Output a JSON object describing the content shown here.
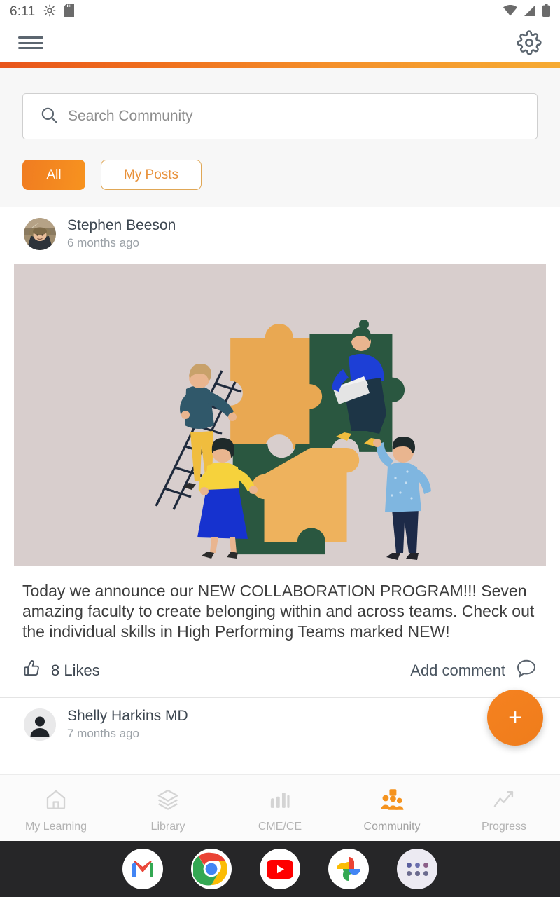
{
  "status_bar": {
    "time": "6:11",
    "icons": [
      "android-debug-icon",
      "sd-card-icon",
      "wifi-icon",
      "cellular-signal-icon",
      "battery-icon"
    ]
  },
  "app_bar": {
    "menu_icon": "hamburger-menu-icon",
    "settings_icon": "gear-icon"
  },
  "theme": {
    "accent_start": "#e8551c",
    "accent_end": "#f6ab33",
    "chip_active_bg": "#f7931f",
    "chip_inactive_text": "#e8913a",
    "fab_color": "#f58220",
    "nav_active_color": "#f5931e",
    "illustration_bg": "#d8cecd",
    "puzzle_orange": "#e9a852",
    "puzzle_green": "#2a5740"
  },
  "search": {
    "placeholder": "Search Community",
    "value": "",
    "icon": "search-icon"
  },
  "filters": [
    {
      "label": "All",
      "active": true
    },
    {
      "label": "My Posts",
      "active": false
    }
  ],
  "posts": [
    {
      "author": "Stephen Beeson",
      "timestamp": "6 months ago",
      "avatar_type": "photo",
      "image": {
        "alt": "illustration-team-assembling-puzzle",
        "description": "Four people assembling a four-piece jigsaw puzzle in orange and dark green on a dusty pink background"
      },
      "body": "Today we announce our NEW COLLABORATION PROGRAM!!! Seven amazing faculty to create belonging within and across teams. Check out the individual skills in High Performing Teams marked NEW!",
      "likes_label": "8 Likes",
      "likes_count": 8,
      "comment_label": "Add comment"
    },
    {
      "author": "Shelly Harkins MD",
      "timestamp": "7 months ago",
      "avatar_type": "placeholder"
    }
  ],
  "fab": {
    "label": "+",
    "name": "create-post-button"
  },
  "bottom_nav": [
    {
      "label": "My Learning",
      "icon": "home-icon",
      "active": false
    },
    {
      "label": "Library",
      "icon": "layers-icon",
      "active": false
    },
    {
      "label": "CME/CE",
      "icon": "bar-chart-icon",
      "active": false
    },
    {
      "label": "Community",
      "icon": "people-group-icon",
      "active": true
    },
    {
      "label": "Progress",
      "icon": "trend-up-icon",
      "active": false
    }
  ],
  "dock": [
    {
      "name": "gmail-icon",
      "label": "Gmail"
    },
    {
      "name": "chrome-icon",
      "label": "Chrome"
    },
    {
      "name": "youtube-icon",
      "label": "YouTube"
    },
    {
      "name": "google-photos-icon",
      "label": "Photos"
    },
    {
      "name": "app-drawer-icon",
      "label": "All apps"
    }
  ]
}
